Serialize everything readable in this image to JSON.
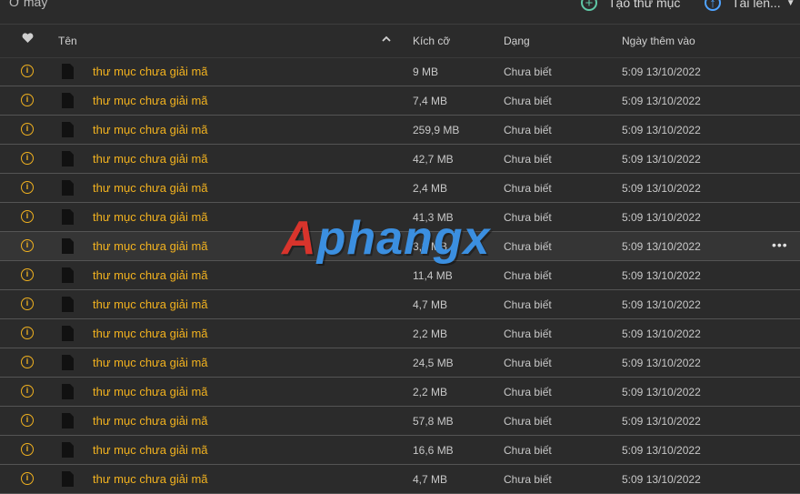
{
  "breadcrumb": "Ở máy",
  "toolbar": {
    "new_folder_label": "Tạo thư mục",
    "upload_label": "Tải lên..."
  },
  "columns": {
    "name": "Tên",
    "size": "Kích cỡ",
    "type": "Dạng",
    "date_added": "Ngày thêm vào"
  },
  "watermark": {
    "part1": "A",
    "part2": "phangx"
  },
  "rows": [
    {
      "name": "thư mục chưa giải mã",
      "size": "9 MB",
      "type": "Chưa biết",
      "date": "5:09 13/10/2022"
    },
    {
      "name": "thư mục chưa giải mã",
      "size": "7,4 MB",
      "type": "Chưa biết",
      "date": "5:09 13/10/2022"
    },
    {
      "name": "thư mục chưa giải mã",
      "size": "259,9 MB",
      "type": "Chưa biết",
      "date": "5:09 13/10/2022"
    },
    {
      "name": "thư mục chưa giải mã",
      "size": "42,7 MB",
      "type": "Chưa biết",
      "date": "5:09 13/10/2022"
    },
    {
      "name": "thư mục chưa giải mã",
      "size": "2,4 MB",
      "type": "Chưa biết",
      "date": "5:09 13/10/2022"
    },
    {
      "name": "thư mục chưa giải mã",
      "size": "41,3 MB",
      "type": "Chưa biết",
      "date": "5:09 13/10/2022"
    },
    {
      "name": "thư mục chưa giải mã",
      "size": "3,8 MB",
      "type": "Chưa biết",
      "date": "5:09 13/10/2022"
    },
    {
      "name": "thư mục chưa giải mã",
      "size": "11,4 MB",
      "type": "Chưa biết",
      "date": "5:09 13/10/2022"
    },
    {
      "name": "thư mục chưa giải mã",
      "size": "4,7 MB",
      "type": "Chưa biết",
      "date": "5:09 13/10/2022"
    },
    {
      "name": "thư mục chưa giải mã",
      "size": "2,2 MB",
      "type": "Chưa biết",
      "date": "5:09 13/10/2022"
    },
    {
      "name": "thư mục chưa giải mã",
      "size": "24,5 MB",
      "type": "Chưa biết",
      "date": "5:09 13/10/2022"
    },
    {
      "name": "thư mục chưa giải mã",
      "size": "2,2 MB",
      "type": "Chưa biết",
      "date": "5:09 13/10/2022"
    },
    {
      "name": "thư mục chưa giải mã",
      "size": "57,8 MB",
      "type": "Chưa biết",
      "date": "5:09 13/10/2022"
    },
    {
      "name": "thư mục chưa giải mã",
      "size": "16,6 MB",
      "type": "Chưa biết",
      "date": "5:09 13/10/2022"
    },
    {
      "name": "thư mục chưa giải mã",
      "size": "4,7 MB",
      "type": "Chưa biết",
      "date": "5:09 13/10/2022"
    }
  ],
  "hovered_row_index": 6,
  "icons": {
    "favorite": "heart-icon",
    "sort": "chevron-up-icon",
    "row_status": "info-icon",
    "row_file": "file-icon",
    "more": "more-icon"
  },
  "colors": {
    "background": "#2b2b2b",
    "accent_name": "#f2b21f",
    "new_folder": "#5fc8a6",
    "upload": "#4fa3ff"
  }
}
